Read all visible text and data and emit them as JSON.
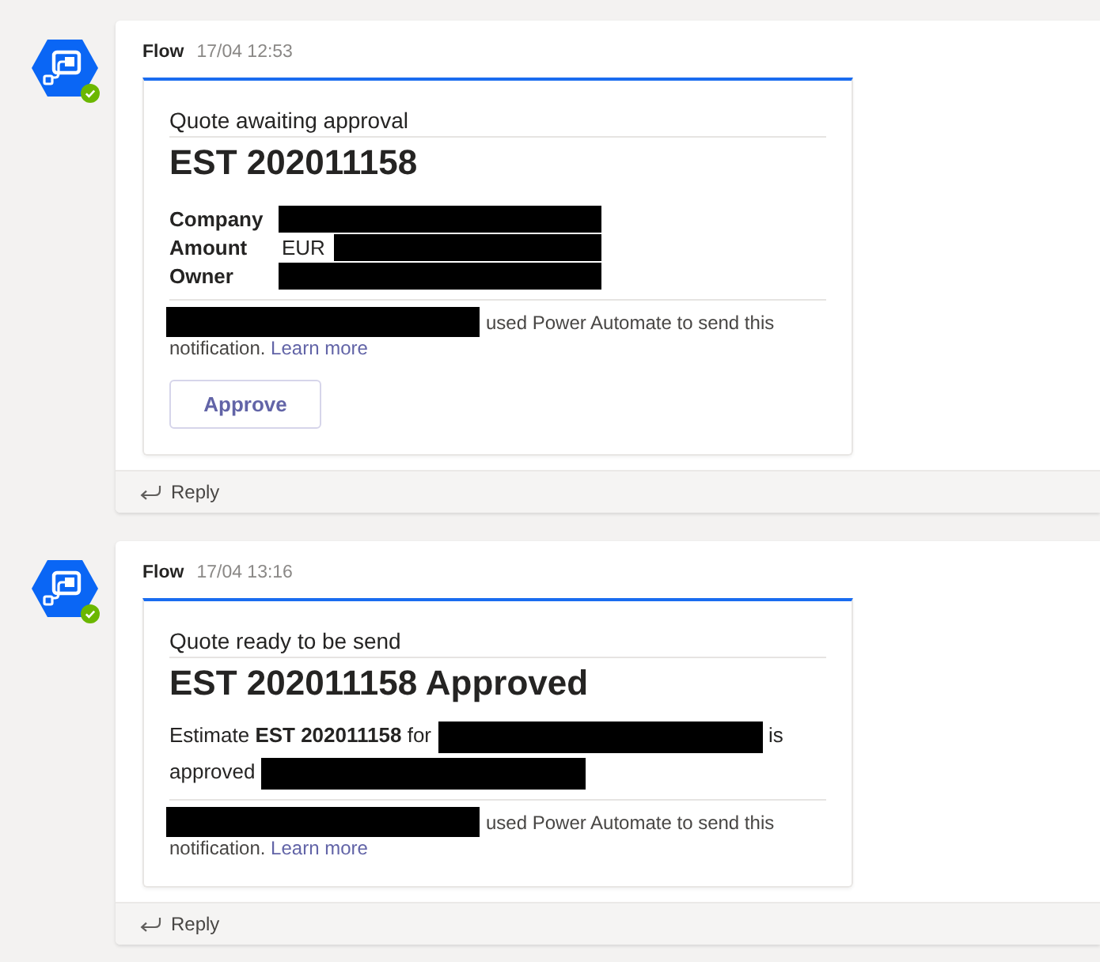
{
  "messages": [
    {
      "sender": "Flow",
      "time": "17/04 12:53",
      "online": true,
      "card": {
        "subtitle": "Quote awaiting approval",
        "title": "EST 202011158",
        "facts": [
          {
            "label": "Company",
            "redacted": true
          },
          {
            "label": "Amount",
            "value": "EUR",
            "redacted": true
          },
          {
            "label": "Owner",
            "redacted": true
          }
        ],
        "note": {
          "sender_redacted": true,
          "text": "used Power Automate to send this notification.",
          "link": "Learn more"
        },
        "actions": [
          {
            "label": "Approve"
          }
        ]
      },
      "reply": "Reply"
    },
    {
      "sender": "Flow",
      "time": "17/04 13:16",
      "online": true,
      "card": {
        "subtitle": "Quote ready to be send",
        "title": "EST 202011158 Approved",
        "body": [
          {
            "kind": "text",
            "text": "Estimate **EST 202011158** for"
          },
          {
            "kind": "redaction"
          },
          {
            "kind": "text",
            "text": "is approved"
          },
          {
            "kind": "redaction"
          }
        ],
        "note": {
          "sender_redacted": true,
          "text": "used Power Automate to send this notification.",
          "link": "Learn more"
        }
      },
      "reply": "Reply"
    }
  ]
}
